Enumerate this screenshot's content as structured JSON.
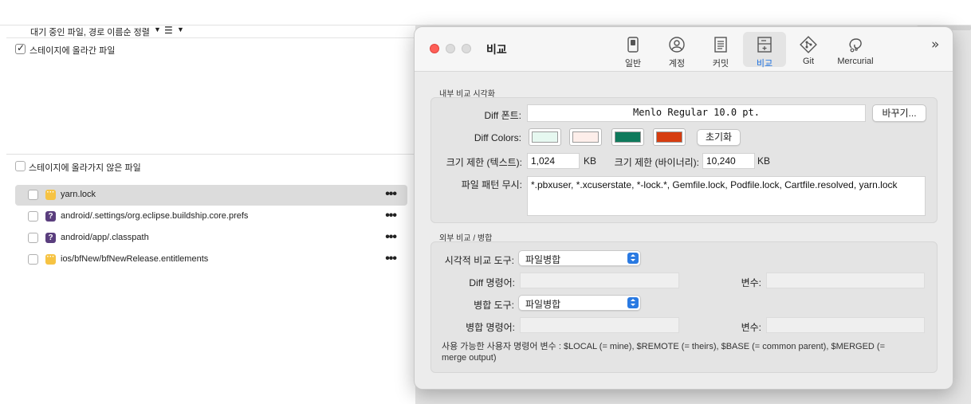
{
  "sidebar": {
    "sort_label": "대기 중인 파일, 경로 이름순 정렬",
    "staged": {
      "label": "스테이지에 올라간 파일",
      "checked": true
    },
    "unstaged": {
      "label": "스테이지에 올라가지 않은 파일",
      "checked": false
    },
    "files": [
      {
        "name": "yarn.lock",
        "status": "modified",
        "selected": true
      },
      {
        "name": "android/.settings/org.eclipse.buildship.core.prefs",
        "status": "untracked",
        "icon_char": "?"
      },
      {
        "name": "android/app/.classpath",
        "status": "untracked",
        "icon_char": "?"
      },
      {
        "name": "ios/bfNew/bfNewRelease.entitlements",
        "status": "modified"
      }
    ],
    "more_glyph": "•••"
  },
  "window": {
    "title": "비교",
    "more_glyph": "»",
    "tabs": [
      {
        "label": "일반",
        "icon": "switch-icon"
      },
      {
        "label": "계정",
        "icon": "account-icon"
      },
      {
        "label": "커밋",
        "icon": "document-icon"
      },
      {
        "label": "비교",
        "icon": "diff-icon",
        "active": true
      },
      {
        "label": "Git",
        "icon": "git-icon"
      },
      {
        "label": "Mercurial",
        "icon": "mercurial-icon"
      }
    ],
    "internal": {
      "title": "내부 비교 시각화",
      "font_label": "Diff 폰트:",
      "font_value": "Menlo Regular 10.0 pt.",
      "change_button": "바꾸기...",
      "colors_label": "Diff Colors:",
      "colors": [
        "#e6f8f0",
        "#fdeeea",
        "#0f7a5c",
        "#d63d10"
      ],
      "reset_button": "초기화",
      "text_limit_label": "크기 제한 (텍스트):",
      "text_limit_value": "1,024",
      "text_limit_unit": "KB",
      "binary_limit_label": "크기 제한 (바이너리):",
      "binary_limit_value": "10,240",
      "binary_limit_unit": "KB",
      "ignore_label": "파일 패턴 무시:",
      "ignore_value": "*.pbxuser, *.xcuserstate, *-lock.*, Gemfile.lock, Podfile.lock, Cartfile.resolved, yarn.lock"
    },
    "external": {
      "title": "외부 비교 / 병합",
      "visual_tool_label": "시각적 비교 도구:",
      "visual_tool_value": "파일병합",
      "diff_cmd_label": "Diff 명령어:",
      "diff_cmd_value": "",
      "diff_args_label": "변수:",
      "diff_args_value": "",
      "merge_tool_label": "병합 도구:",
      "merge_tool_value": "파일병합",
      "merge_cmd_label": "병합 명령어:",
      "merge_cmd_value": "",
      "merge_args_label": "변수:",
      "merge_args_value": "",
      "note": "사용 가능한 사용자 명령어 변수 : $LOCAL (= mine), $REMOTE (= theirs), $BASE (= common parent), $MERGED (= merge output)"
    }
  }
}
